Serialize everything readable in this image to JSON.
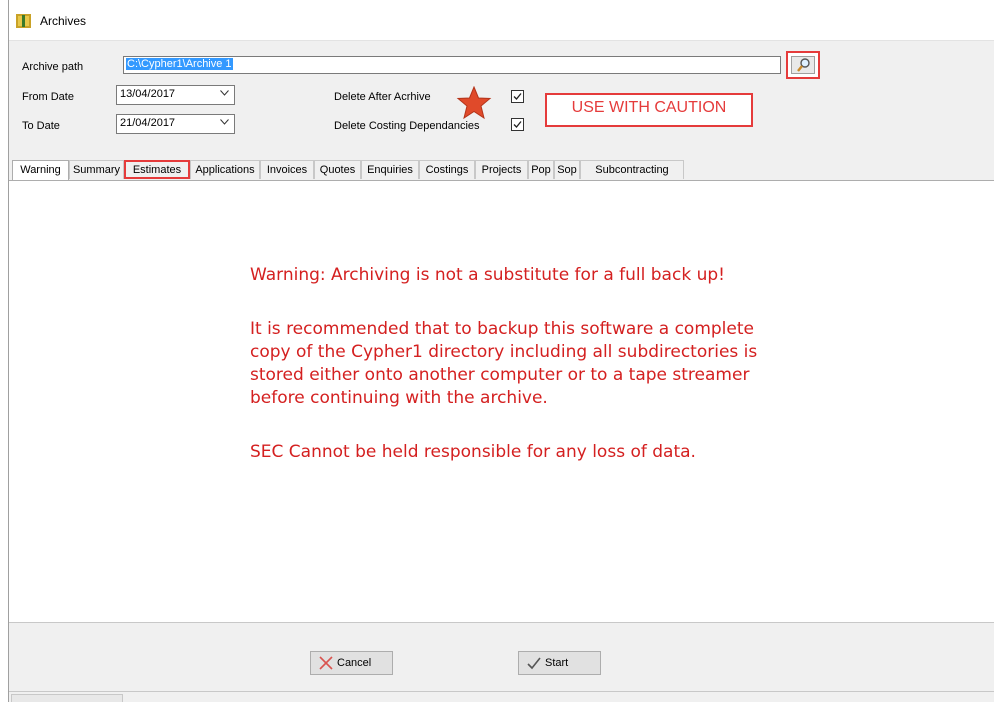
{
  "window": {
    "title": "Archives"
  },
  "form": {
    "archive_path_label": "Archive path",
    "archive_path_value": "C:\\Cypher1\\Archive 1",
    "from_date_label": "From Date",
    "from_date_value": "13/04/2017",
    "to_date_label": "To Date",
    "to_date_value": "21/04/2017",
    "delete_after_archive_label": "Delete After Acrhive",
    "delete_after_archive_checked": true,
    "delete_costing_label": "Delete Costing Dependancies",
    "delete_costing_checked": true
  },
  "annotation": {
    "caution_text": "USE WITH CAUTION"
  },
  "tabs": [
    {
      "label": "Warning",
      "active": true
    },
    {
      "label": "Summary"
    },
    {
      "label": "Estimates",
      "highlighted": true
    },
    {
      "label": "Applications"
    },
    {
      "label": "Invoices"
    },
    {
      "label": "Quotes"
    },
    {
      "label": "Enquiries"
    },
    {
      "label": "Costings"
    },
    {
      "label": "Projects"
    },
    {
      "label": "Pop"
    },
    {
      "label": "Sop"
    },
    {
      "label": "Subcontracting"
    }
  ],
  "warning": {
    "line1": "Warning: Archiving is not a substitute for a full back up!",
    "para2": [
      "It is recommended that to backup this software a complete",
      "copy of the Cypher1 directory including all subdirectories is",
      "stored either onto another computer or to a tape streamer",
      "before continuing with the archive."
    ],
    "line3": "SEC Cannot be held responsible for any loss of data."
  },
  "buttons": {
    "cancel": "Cancel",
    "start": "Start"
  },
  "colors": {
    "warning_text": "#d42020",
    "highlight": "#e53b3b",
    "selection": "#3399ff"
  }
}
